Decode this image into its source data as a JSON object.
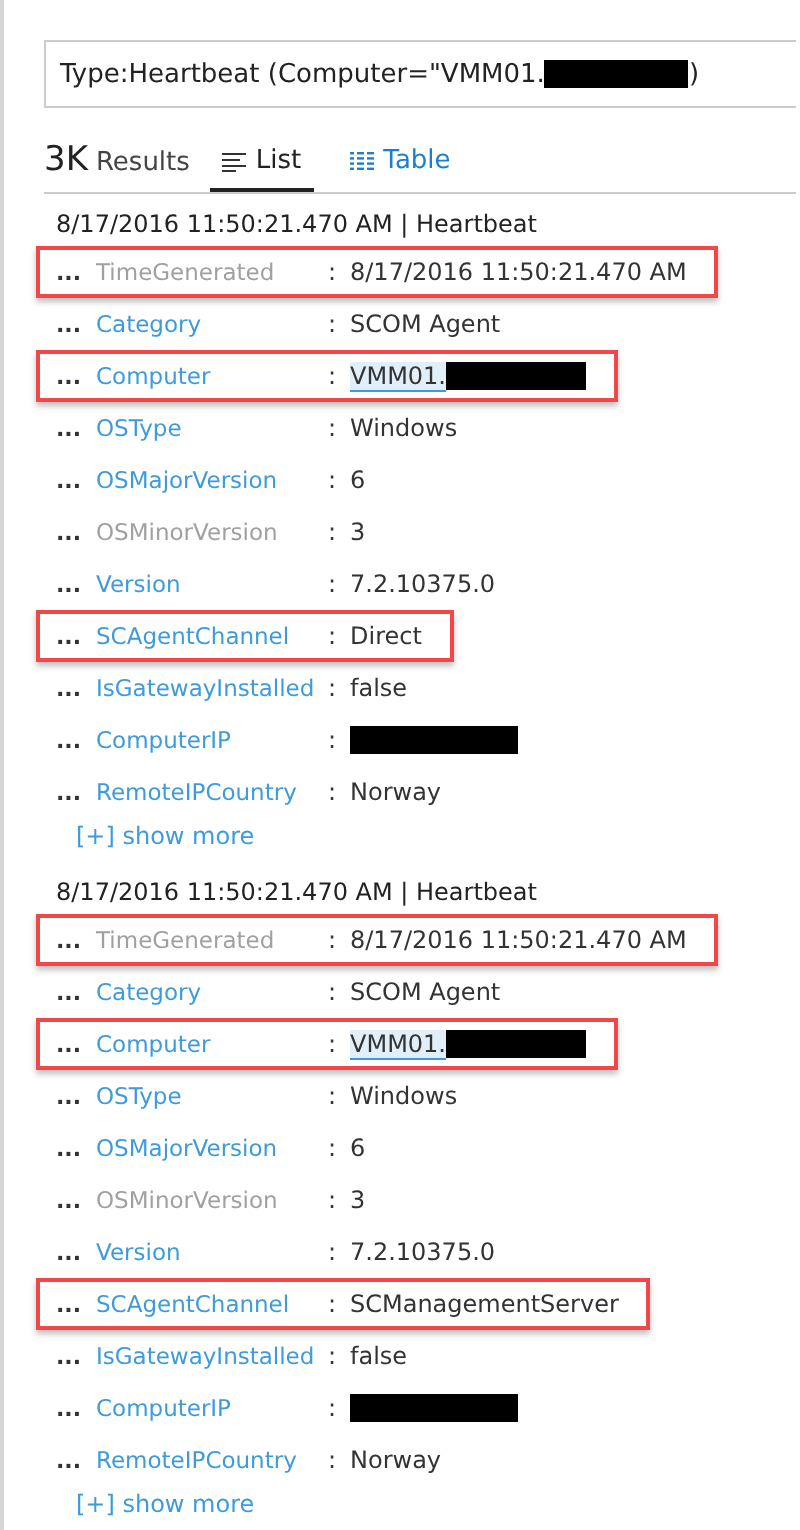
{
  "query": {
    "text": "Type:Heartbeat (Computer=\"VMM01.",
    "redacted": true,
    "text_after": ")"
  },
  "results": {
    "count": "3K",
    "label": "Results"
  },
  "tabs": [
    {
      "label": "List",
      "selected": true
    },
    {
      "label": "Table",
      "selected": false
    }
  ],
  "records": [
    {
      "header": "8/17/2016 11:50:21.470 AM | Heartbeat",
      "fields": [
        {
          "menu": "...",
          "name": "TimeGenerated",
          "separator": ":",
          "value": "8/17/2016 11:50:21.470 AM",
          "dimmed": true,
          "highlighted": true
        },
        {
          "menu": "...",
          "name": "Category",
          "separator": ":",
          "value": "SCOM Agent",
          "dimmed": false
        },
        {
          "menu": "...",
          "name": "Computer",
          "separator": ":",
          "value": "VMM01.",
          "dimmed": false,
          "highlighted": true,
          "link": true,
          "redacted": true
        },
        {
          "menu": "...",
          "name": "OSType",
          "separator": ":",
          "value": "Windows",
          "dimmed": false
        },
        {
          "menu": "...",
          "name": "OSMajorVersion",
          "separator": ":",
          "value": "6",
          "dimmed": false
        },
        {
          "menu": "...",
          "name": "OSMinorVersion",
          "separator": ":",
          "value": "3",
          "dimmed": true
        },
        {
          "menu": "...",
          "name": "Version",
          "separator": ":",
          "value": "7.2.10375.0",
          "dimmed": false
        },
        {
          "menu": "...",
          "name": "SCAgentChannel",
          "separator": ":",
          "value": "Direct",
          "dimmed": false,
          "highlighted": true
        },
        {
          "menu": "...",
          "name": "IsGatewayInstalled",
          "separator": ":",
          "value": "false",
          "dimmed": false
        },
        {
          "menu": "...",
          "name": "ComputerIP",
          "separator": ":",
          "dimmed": false,
          "redacted": true
        },
        {
          "menu": "...",
          "name": "RemoteIPCountry",
          "separator": ":",
          "value": "Norway",
          "dimmed": false
        }
      ],
      "show_more": "[+] show more"
    },
    {
      "header": "8/17/2016 11:50:21.470 AM | Heartbeat",
      "fields": [
        {
          "menu": "...",
          "name": "TimeGenerated",
          "separator": ":",
          "value": "8/17/2016 11:50:21.470 AM",
          "dimmed": true,
          "highlighted": true
        },
        {
          "menu": "...",
          "name": "Category",
          "separator": ":",
          "value": "SCOM Agent",
          "dimmed": false
        },
        {
          "menu": "...",
          "name": "Computer",
          "separator": ":",
          "value": "VMM01.",
          "dimmed": false,
          "highlighted": true,
          "link": true,
          "redacted": true
        },
        {
          "menu": "...",
          "name": "OSType",
          "separator": ":",
          "value": "Windows",
          "dimmed": false
        },
        {
          "menu": "...",
          "name": "OSMajorVersion",
          "separator": ":",
          "value": "6",
          "dimmed": false
        },
        {
          "menu": "...",
          "name": "OSMinorVersion",
          "separator": ":",
          "value": "3",
          "dimmed": true
        },
        {
          "menu": "...",
          "name": "Version",
          "separator": ":",
          "value": "7.2.10375.0",
          "dimmed": false
        },
        {
          "menu": "...",
          "name": "SCAgentChannel",
          "separator": ":",
          "value": "SCManagementServer",
          "dimmed": false,
          "highlighted": true
        },
        {
          "menu": "...",
          "name": "IsGatewayInstalled",
          "separator": ":",
          "value": "false",
          "dimmed": false
        },
        {
          "menu": "...",
          "name": "ComputerIP",
          "separator": ":",
          "dimmed": false,
          "redacted": true
        },
        {
          "menu": "...",
          "name": "RemoteIPCountry",
          "separator": ":",
          "value": "Norway",
          "dimmed": false
        }
      ],
      "show_more": "[+] show more"
    }
  ]
}
